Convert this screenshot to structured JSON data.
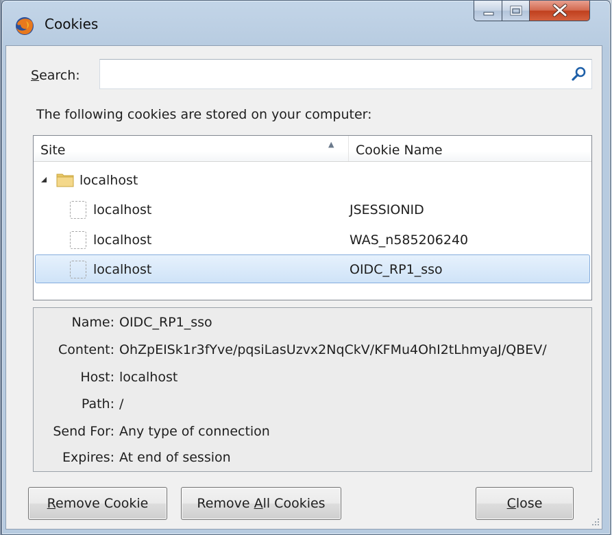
{
  "window": {
    "title": "Cookies",
    "icon": "firefox-icon"
  },
  "titlebar_buttons": {
    "minimize": "minimize-icon",
    "maximize": "maximize-icon",
    "close": "close-icon"
  },
  "search": {
    "label_accesskey": "S",
    "label_rest": "earch:",
    "value": "",
    "placeholder": "",
    "icon": "search-icon"
  },
  "info_text": "The following cookies are stored on your computer:",
  "tree": {
    "columns": {
      "site": "Site",
      "cookie_name": "Cookie Name",
      "sort_indicator": "ascending"
    },
    "rows": [
      {
        "type": "folder",
        "site": "localhost",
        "cookie": "",
        "expanded": true,
        "selected": false
      },
      {
        "type": "cookie",
        "site": "localhost",
        "cookie": "JSESSIONID",
        "selected": false
      },
      {
        "type": "cookie",
        "site": "localhost",
        "cookie": "WAS_n585206240",
        "selected": false
      },
      {
        "type": "cookie",
        "site": "localhost",
        "cookie": "OIDC_RP1_sso",
        "selected": true
      }
    ]
  },
  "details": {
    "name_label": "Name:",
    "name_value": "OIDC_RP1_sso",
    "content_label": "Content:",
    "content_value": "OhZpEISk1r3fYve/pqsiLasUzvx2NqCkV/KFMu4OhI2tLhmyaJ/QBEV/",
    "host_label": "Host:",
    "host_value": "localhost",
    "path_label": "Path:",
    "path_value": "/",
    "sendfor_label": "Send For:",
    "sendfor_value": "Any type of connection",
    "expires_label": "Expires:",
    "expires_value": "At end of session"
  },
  "buttons": {
    "remove_cookie_accesskey": "R",
    "remove_cookie_rest": "emove Cookie",
    "remove_all_pre": "Remove ",
    "remove_all_accesskey": "A",
    "remove_all_rest": "ll Cookies",
    "close_accesskey": "C",
    "close_rest": "lose"
  },
  "colors": {
    "selection_fill": "#cfe3f8",
    "selection_border": "#84acdd",
    "close_button": "#c0401e"
  }
}
